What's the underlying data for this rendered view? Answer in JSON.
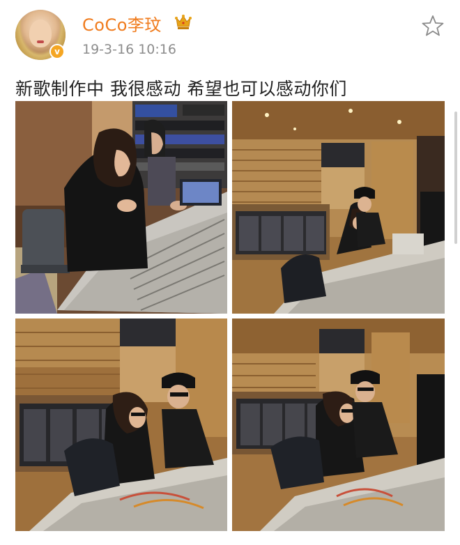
{
  "post": {
    "username": "CoCo李玟",
    "timestamp": "19-3-16 10:16",
    "text": "新歌制作中 我很感动 希望也可以感动你们"
  },
  "icons": {
    "verified": "verified-badge-icon",
    "verified_glyph": "v",
    "crown": "crown-icon",
    "follow": "star-outline-icon"
  },
  "colors": {
    "username": "#f07c1e",
    "verified_badge": "#f5a623",
    "crown": "#e8a317",
    "timestamp": "#8c8c8c",
    "text": "#222222"
  },
  "photos": [
    {
      "scene": "recording-studio-console-close"
    },
    {
      "scene": "recording-studio-wide"
    },
    {
      "scene": "recording-studio-console-mid"
    },
    {
      "scene": "recording-studio-wide-2"
    }
  ]
}
